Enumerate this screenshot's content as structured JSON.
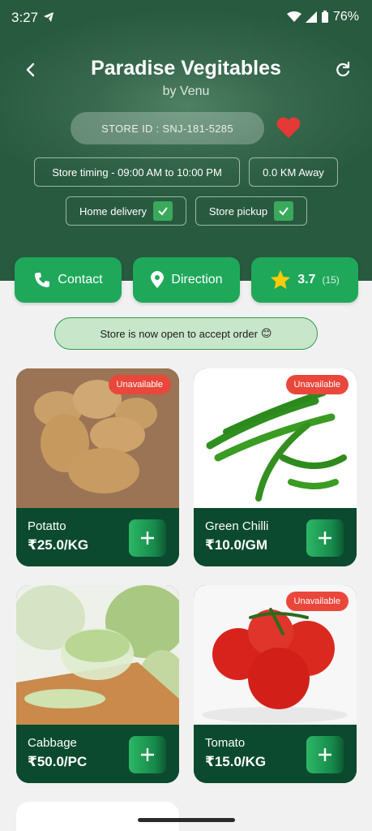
{
  "status": {
    "time": "3:27",
    "battery": "76%"
  },
  "header": {
    "title": "Paradise Vegitables",
    "subtitle": "by Venu",
    "store_id": "STORE ID : SNJ-181-5285",
    "timing": "Store timing - 09:00 AM to 10:00 PM",
    "distance": "0.0 KM Away",
    "home_delivery": "Home delivery",
    "store_pickup": "Store pickup"
  },
  "actions": {
    "contact": "Contact",
    "direction": "Direction",
    "rating": "3.7",
    "rating_count": "(15)"
  },
  "banner": {
    "text": "Store is now open to accept order",
    "emoji": "😊"
  },
  "products": [
    {
      "name": "Potatto",
      "price": "₹25.0/KG",
      "badge": "Unavailable"
    },
    {
      "name": "Green Chilli",
      "price": "₹10.0/GM",
      "badge": "Unavailable"
    },
    {
      "name": "Cabbage",
      "price": "₹50.0/PC",
      "badge": ""
    },
    {
      "name": "Tomato",
      "price": "₹15.0/KG",
      "badge": "Unavailable"
    }
  ],
  "colors": {
    "accent": "#1fa85a",
    "card": "#0b4a2e",
    "badge": "#e9473b",
    "heart": "#e53935"
  },
  "icons": [
    "back-arrow-icon",
    "refresh-icon",
    "heart-icon",
    "phone-icon",
    "location-pin-icon",
    "star-icon",
    "check-icon",
    "plus-icon"
  ]
}
